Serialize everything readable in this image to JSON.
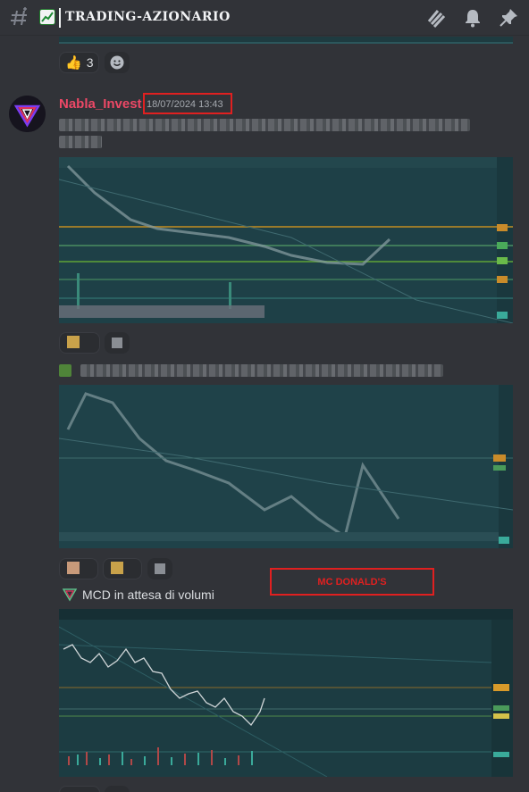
{
  "header": {
    "channel_name": "TRADING-AZIONARIO",
    "icons": [
      "hash-icon",
      "chart-increasing-icon",
      "threads-icon",
      "bell-icon",
      "pin-icon"
    ]
  },
  "prev_message": {
    "reaction_count": "3",
    "reaction_emoji": "👍"
  },
  "message": {
    "username": "Nabla_Invest",
    "timestamp": "18/07/2024 13:43",
    "caption": "MCD in attesa di volumi",
    "overlay_label": "MC DONALD'S"
  },
  "colors": {
    "background": "#313338",
    "username": "#ed4866",
    "highlight_red": "#e02020",
    "chart_bg": "#1d3f45"
  }
}
